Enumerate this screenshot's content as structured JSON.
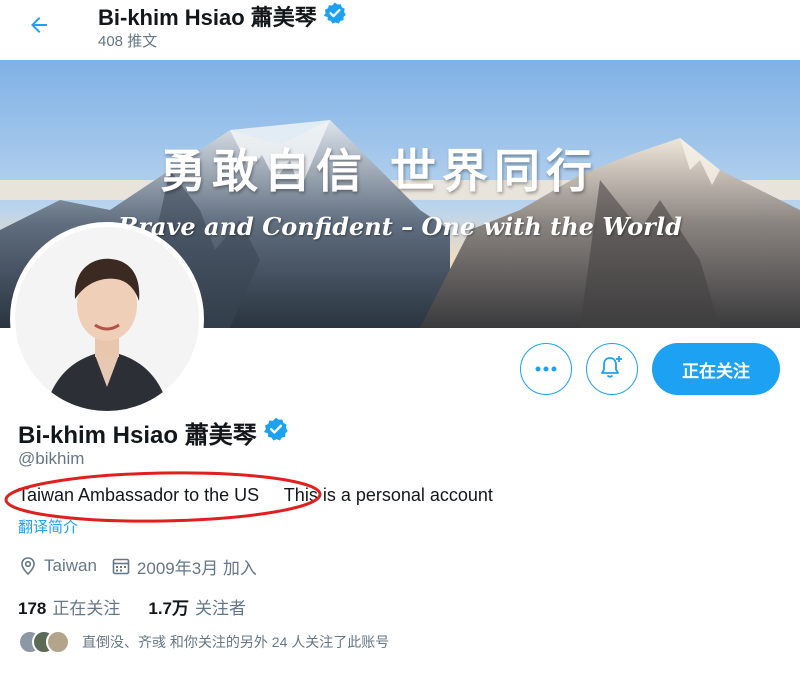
{
  "header": {
    "display_name": "Bi-khim Hsiao 蕭美琴",
    "tweet_count": "408 推文"
  },
  "banner": {
    "title_zh": "勇敢自信 世界同行",
    "title_en": "Brave and Confident – One with the World"
  },
  "actions": {
    "following_label": "正在关注"
  },
  "profile": {
    "display_name": "Bi-khim Hsiao 蕭美琴",
    "handle": "@bikhim",
    "bio": "Taiwan Ambassador to the US     This is a personal account",
    "translate_label": "翻译简介",
    "location": "Taiwan",
    "joined": "2009年3月 加入"
  },
  "stats": {
    "following_count": "178",
    "following_label": "正在关注",
    "followers_count": "1.7万",
    "followers_label": "关注者"
  },
  "followers_you_know": {
    "text": "直倒没、齐彧 和你关注的另外 24 人关注了此账号"
  },
  "colors": {
    "accent": "#1da1f2",
    "secondary_text": "#657786",
    "annotation": "#e0201f"
  },
  "icons": [
    "back-arrow-icon",
    "verified-badge-icon",
    "more-icon",
    "bell-plus-icon",
    "location-icon",
    "calendar-icon"
  ]
}
